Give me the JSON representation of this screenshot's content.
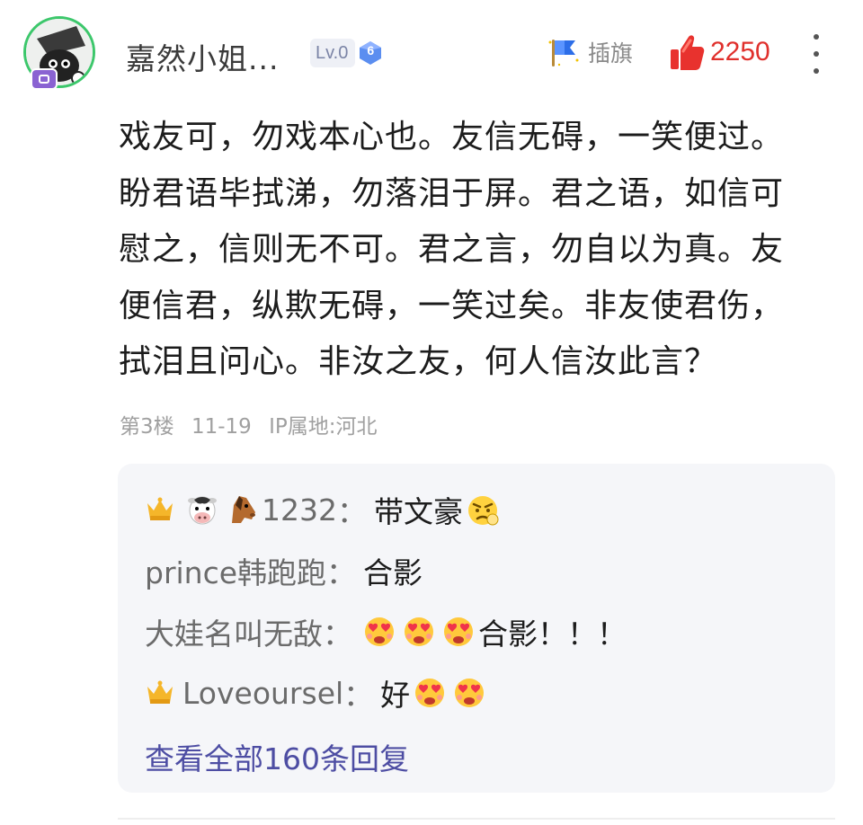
{
  "header": {
    "username": "嘉然小姐...",
    "level": "Lv.0",
    "level_badge_number": "6",
    "flag_label": "插旗",
    "like_count": "2250"
  },
  "post": {
    "lines": [
      "戏友可，勿戏本心也。友信无碍，一笑便过。",
      "盼君语毕拭涕，勿落泪于屏。君之语，如信可",
      "慰之，信则无不可。君之言，勿自以为真。友",
      "便信君，纵欺无碍，一笑过矣。非友使君伤，",
      "拭泪且问心。非汝之友，何人信汝此言？"
    ],
    "floor": "第3楼",
    "date": "11-19",
    "location": "IP属地:河北"
  },
  "replies": {
    "items": [
      {
        "author": "1232",
        "separator": "：",
        "text": "带文豪"
      },
      {
        "author": "prince韩跑跑",
        "separator": "：",
        "text": "合影"
      },
      {
        "author": "大娃名叫无敌",
        "separator": "：",
        "text": "合影！！！"
      },
      {
        "author": "Loveoursel",
        "separator": "：",
        "text": "好"
      }
    ],
    "view_all_label": "查看全部160条回复"
  },
  "colors": {
    "like_red": "#e0302c",
    "link_purple": "#4d4da3",
    "avatar_ring": "#3cc76b",
    "level_gem": "#5b8ef0"
  },
  "icons": {
    "flag": "flag-icon",
    "like": "thumbs-up-icon",
    "more": "more-vertical-icon",
    "crown": "crown-icon",
    "emoji_love": "heart-eyes-emoji",
    "emoji_angry": "angry-emoji",
    "emoji_cow": "cow-face-emoji",
    "emoji_horse": "horse-face-emoji"
  }
}
